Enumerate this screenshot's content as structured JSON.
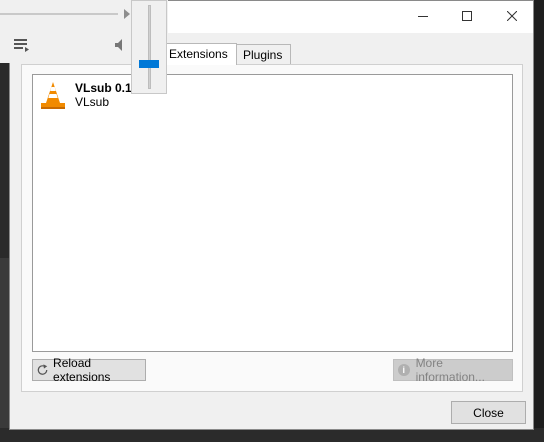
{
  "window_controls": {
    "minimize_icon": "minimize-icon",
    "maximize_icon": "maximize-icon",
    "close_icon": "close-icon"
  },
  "tabs": [
    {
      "label": "Extensions",
      "active": true
    },
    {
      "label": "Plugins",
      "active": false
    }
  ],
  "extensions": [
    {
      "name": "VLsub 0.11",
      "author": "VLsub",
      "icon": "vlc-cone-icon"
    }
  ],
  "buttons": {
    "reload": "Reload extensions",
    "more_info": "More information...",
    "close": "Close"
  },
  "player": {
    "volume_level": 0.3
  },
  "colors": {
    "accent": "#0078d7",
    "dialog_bg": "#f0f0f0",
    "backdrop": "#1e1e1e"
  }
}
